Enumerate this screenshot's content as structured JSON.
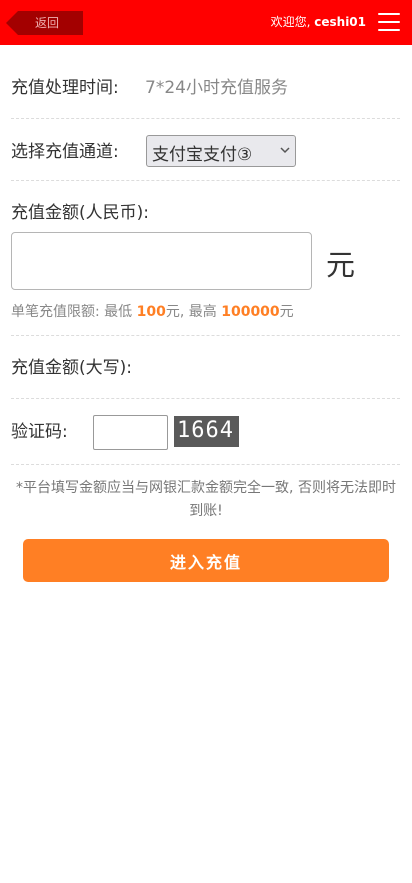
{
  "header": {
    "back_label": "返回",
    "welcome_prefix": "欢迎您, ",
    "username": "ceshi01",
    "menu_icon": "hamburger-menu-icon",
    "bar_color": "#ff0000"
  },
  "form": {
    "processing_time": {
      "label": "充值处理时间:",
      "value": "7*24小时充值服务"
    },
    "channel": {
      "label": "选择充值通道:",
      "selected": "支付宝支付③"
    },
    "amount": {
      "label": "充值金额(人民币):",
      "value": "",
      "unit": "元",
      "limit_prefix": "单笔充值限额: 最低 ",
      "limit_min": "100",
      "limit_mid": "元, 最高 ",
      "limit_max": "100000",
      "limit_suffix": "元"
    },
    "amount_upper": {
      "label": "充值金额(大写):"
    },
    "captcha": {
      "label": "验证码:",
      "value": "",
      "image_text": "1664"
    }
  },
  "notice": "*平台填写金额应当与网银汇款金额完全一致, 否则将无法即时到账!",
  "submit_label": "进入充值",
  "accent_color": "#ff7f24"
}
